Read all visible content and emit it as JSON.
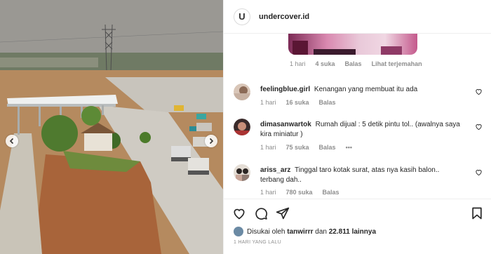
{
  "post": {
    "username": "undercover.id",
    "avatar_letter": "U",
    "icons": [
      "chevron-left-icon",
      "chevron-right-icon"
    ]
  },
  "first_reply_meta": {
    "time": "1 hari",
    "likes": "4 suka",
    "reply": "Balas",
    "translate": "Lihat terjemahan"
  },
  "comments": [
    {
      "user": "feelingblue.girl",
      "text": "Kenangan yang membuat itu ada",
      "time": "1 hari",
      "likes": "16 suka",
      "reply": "Balas"
    },
    {
      "user": "dimasanwartok",
      "text": "Rumah dijual : 5 detik pintu tol.. (awalnya saya kira miniatur )",
      "time": "1 hari",
      "likes": "75 suka",
      "reply": "Balas",
      "more": "•••"
    },
    {
      "user": "ariss_arz",
      "text": "Tinggal taro kotak surat, atas nya kasih balon.. terbang dah..",
      "time": "1 hari",
      "likes": "780 suka",
      "reply": "Balas"
    }
  ],
  "likes_line": {
    "prefix": "Disukai oleh",
    "user": "tanwirrr",
    "middle": "dan",
    "count": "22.811 lainnya"
  },
  "date": "1 HARI YANG LALU",
  "colors": {
    "muted": "#8e8e8e",
    "text": "#262626",
    "border": "#efefef"
  }
}
